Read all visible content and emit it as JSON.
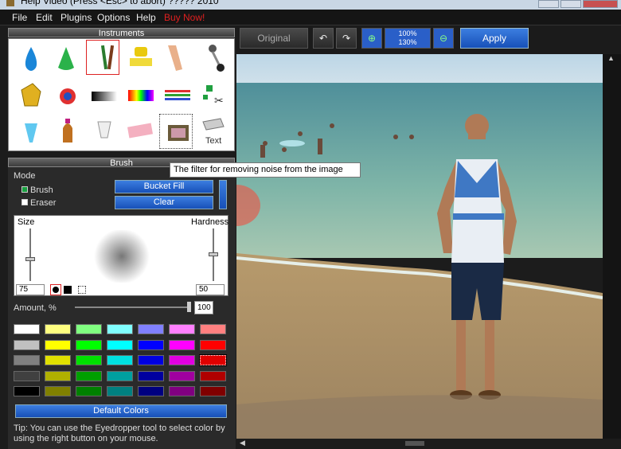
{
  "window": {
    "title": "Help Video (Press <Esc> to abort) ????? 2010"
  },
  "menu": {
    "items": [
      "File",
      "Edit",
      "Plugins",
      "Options",
      "Help"
    ],
    "buy": "Buy Now!"
  },
  "instruments": {
    "title": "Instruments",
    "text_tool": "Text"
  },
  "brush": {
    "title": "Brush",
    "mode_label": "Mode",
    "brush_option": "Brush",
    "eraser_option": "Eraser",
    "bucket_fill": "Bucket Fill",
    "clear": "Clear",
    "size_label": "Size",
    "hardness_label": "Hardness",
    "size_value": "75",
    "hardness_value": "50",
    "amount_label": "Amount, %",
    "amount_value": "100",
    "default_colors": "Default Colors",
    "tip": "Tip: You can use the Eyedropper tool to select color by using the right button on your mouse."
  },
  "palette": [
    [
      "#ffffff",
      "#ffff80",
      "#80ff80",
      "#80ffff",
      "#8080ff",
      "#ff80ff",
      "#ff8080"
    ],
    [
      "#c0c0c0",
      "#ffff00",
      "#00ff00",
      "#00ffff",
      "#0000ff",
      "#ff00ff",
      "#ff0000"
    ],
    [
      "#808080",
      "#e0e000",
      "#00e000",
      "#00e0e0",
      "#0000e0",
      "#e000e0",
      "#e00000"
    ],
    [
      "#404040",
      "#b0b000",
      "#00a000",
      "#00a0a0",
      "#0000a0",
      "#a000a0",
      "#b00000"
    ],
    [
      "#000000",
      "#808000",
      "#008000",
      "#008080",
      "#000080",
      "#800080",
      "#800000"
    ]
  ],
  "toolbar": {
    "original": "Original",
    "zoom_in": "100%",
    "zoom_out": "130%",
    "apply": "Apply"
  },
  "tooltip": "The filter for removing noise from the image"
}
